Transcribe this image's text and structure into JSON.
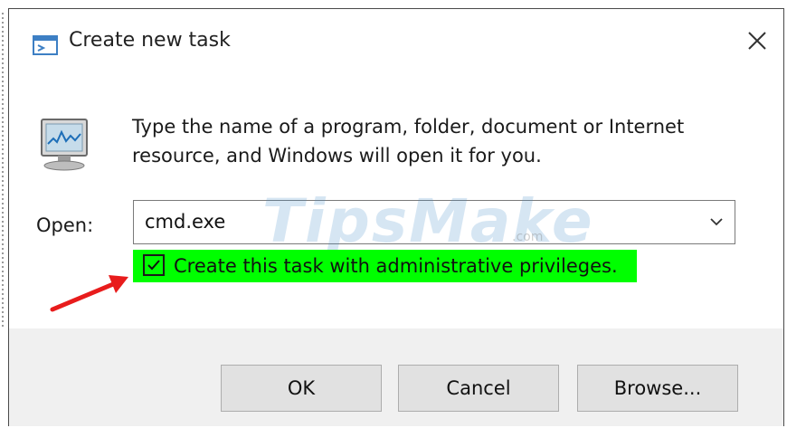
{
  "window": {
    "title": "Create new task",
    "title_icon": "run-window-icon",
    "close_icon": "close-icon"
  },
  "description": "Type the name of a program, folder, document or Internet resource, and Windows will open it for you.",
  "app_icon": "computer-monitor-icon",
  "open": {
    "label": "Open:",
    "value": "cmd.exe",
    "dropdown_icon": "chevron-down-icon"
  },
  "admin_checkbox": {
    "label": "Create this task with administrative privileges.",
    "checked": true,
    "highlight_color": "#00ff00"
  },
  "annotation": {
    "arrow_color": "#e81c1c",
    "arrow_icon": "red-arrow-icon"
  },
  "watermark": {
    "text": "TipsMake",
    "suffix": ".com"
  },
  "buttons": {
    "ok": "OK",
    "cancel": "Cancel",
    "browse": "Browse..."
  }
}
